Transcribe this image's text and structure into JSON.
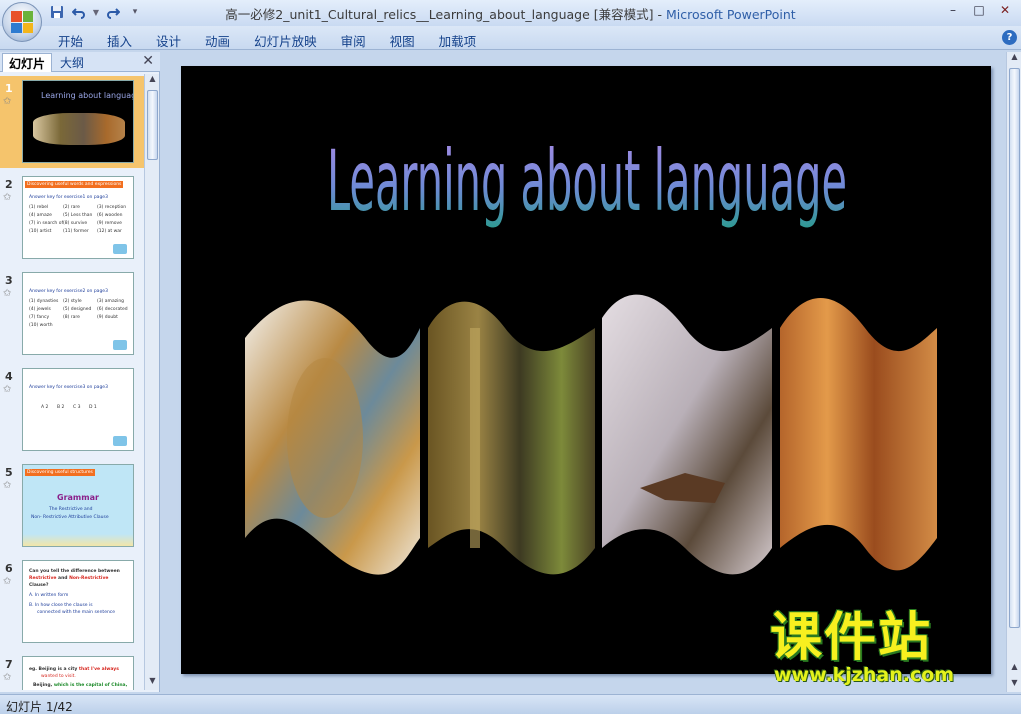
{
  "window": {
    "title_doc": "高一必修2_unit1_Cultural_relics__Learning_about_language [兼容模式]",
    "title_sep": " - ",
    "title_app": "Microsoft PowerPoint",
    "controls": {
      "minimize": "–",
      "maximize": "□",
      "close": "✕"
    }
  },
  "quick_access": {
    "save_icon": "floppy-disk-icon",
    "undo_icon": "undo-icon",
    "redo_icon": "redo-icon",
    "customize_icon": "dropdown-icon"
  },
  "ribbon": {
    "tabs": [
      "开始",
      "插入",
      "设计",
      "动画",
      "幻灯片放映",
      "审阅",
      "视图",
      "加载项"
    ],
    "help": "?"
  },
  "left_pane": {
    "tab_slides": "幻灯片",
    "tab_outline": "大纲",
    "close": "✕",
    "slides": [
      {
        "num": "1",
        "title": "Learning about language"
      },
      {
        "num": "2",
        "header": "Discovering useful words and expressions",
        "sub": "Answer key for exercise1 on page3",
        "items": [
          "(1) rebel",
          "(2) rare",
          "(3) reception",
          "(4) amaze",
          "(5) Less than",
          "(6) wooden",
          "(7) in search of",
          "(8) survive",
          "(9) remove",
          "(10) artist",
          "(11) former",
          "(12) at war"
        ]
      },
      {
        "num": "3",
        "sub": "Answer key for exercise2 on page3",
        "items": [
          "(1) dynasties",
          "(2) style",
          "(3) amazing",
          "(4) jewels",
          "(5) designed",
          "(6) decorated",
          "(7) fancy",
          "(8) rare",
          "(9) doubt",
          "(10) worth"
        ]
      },
      {
        "num": "4",
        "sub": "Answer key for exercise3 on page3",
        "items": [
          "A 2",
          "B 2",
          "C 3",
          "D 1"
        ]
      },
      {
        "num": "5",
        "header": "Discovering useful structures",
        "big": "Grammar",
        "l1": "The Restrictive and",
        "l2": "Non- Restrictive Attributive Clause"
      },
      {
        "num": "6",
        "q1": "Can you tell the difference between",
        "r": "Restrictive",
        "and": " and ",
        "nr": "Non-Restrictive",
        "q2": "Clause?",
        "a": "A. In written form",
        "b1": "B. In how close the clause is",
        "b2": "connected with the main sentence"
      },
      {
        "num": "7",
        "l1": "eg. Beijing   is a city",
        "l1b": " that I've always",
        "l2": "wanted to visit.",
        "l3": "Beijing,",
        "l3b": " which is the capital of China,"
      }
    ]
  },
  "slide": {
    "title": "Learning about language"
  },
  "watermark": {
    "cn": "课件站",
    "url": "www.kjzhan.com"
  },
  "status": {
    "text": "幻灯片 1/42"
  },
  "colors": {
    "title_gradient_top": "#9b7fe0",
    "title_gradient_bottom": "#2a8f9a",
    "accent_orange": "#f26f1f",
    "watermark_yellow": "#f7f01f"
  }
}
